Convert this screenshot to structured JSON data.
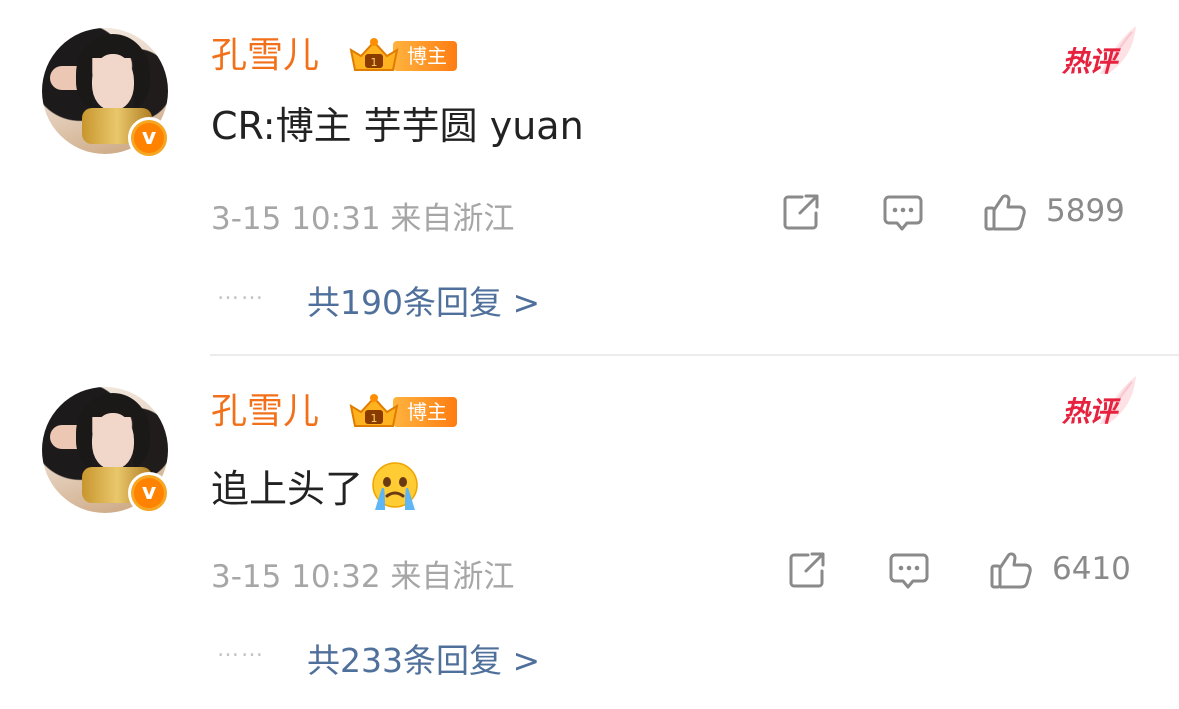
{
  "comments": [
    {
      "author": "孔雪儿",
      "role_badge": "博主",
      "hot_label": "热评",
      "text": "CR:博主 芋芋圆 yuan",
      "emoji": "",
      "meta": "3-15 10:31  来自浙江",
      "likes": "5899",
      "replies_prefix": "……",
      "replies": "共190条回复 >"
    },
    {
      "author": "孔雪儿",
      "role_badge": "博主",
      "hot_label": "热评",
      "text": "追上头了",
      "emoji": "crying-face-emoji",
      "meta": "3-15 10:32  来自浙江",
      "likes": "6410",
      "replies_prefix": "……",
      "replies": "共233条回复 >"
    }
  ],
  "colors": {
    "author": "#f2701a",
    "hot": "#e6223f",
    "meta": "#a6a6a6",
    "replies": "#50709c",
    "badge_gradient_start": "#ffb33f",
    "badge_gradient_end": "#ff7d12"
  },
  "icons": {
    "share": "share-icon",
    "comment": "comment-icon",
    "like": "thumbs-up-icon",
    "verified": "verified-v-icon",
    "crown": "crown-icon"
  }
}
